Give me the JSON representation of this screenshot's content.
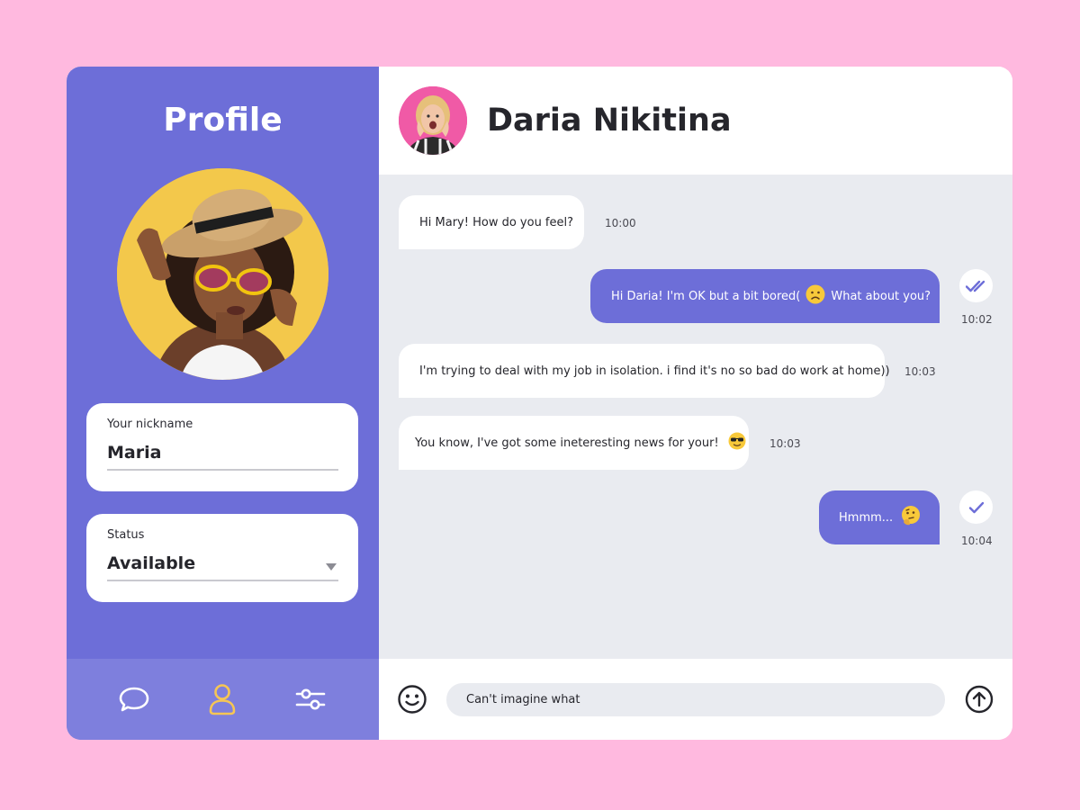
{
  "sidebar": {
    "title": "Profile",
    "nickname": {
      "label": "Your nickname",
      "value": "Maria"
    },
    "status": {
      "label": "Status",
      "value": "Available"
    },
    "nav": [
      {
        "icon": "chat-bubble-icon",
        "active": false
      },
      {
        "icon": "user-icon",
        "active": true
      },
      {
        "icon": "sliders-icon",
        "active": false
      }
    ]
  },
  "chat": {
    "contact_name": "Daria Nikitina",
    "messages": [
      {
        "direction": "in",
        "text": "Hi Mary! How do you feel?",
        "time": "10:00"
      },
      {
        "direction": "out",
        "text_before": "Hi Daria! I'm OK but a bit bored(",
        "emoji": "frowning-face-emoji",
        "text_after": "What about you?",
        "time": "10:02",
        "status": "read"
      },
      {
        "direction": "in",
        "text": "I'm trying to deal with my job in isolation. i find it's no so bad do work at home))",
        "time": "10:03"
      },
      {
        "direction": "in",
        "text": "You know, I've got some ineteresting news for your!",
        "emoji": "sunglasses-emoji",
        "time": "10:03"
      },
      {
        "direction": "out",
        "text": "Hmmm...",
        "emoji": "thinking-face-emoji",
        "time": "10:04",
        "status": "sent"
      }
    ],
    "composer": {
      "value": "Can't imagine what"
    }
  },
  "colors": {
    "background": "#ffb9df",
    "accent": "#6d6ed8",
    "nav_active": "#f6c654",
    "chat_bg": "#e9ebf0"
  }
}
